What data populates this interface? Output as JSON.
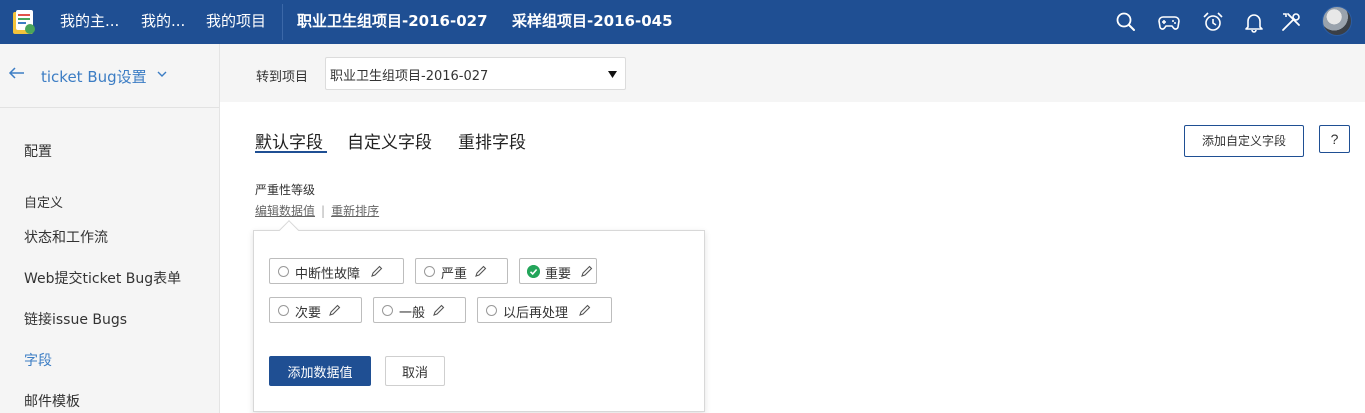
{
  "topbar": {
    "nav": [
      "我的主...",
      "我的...",
      "我的项目",
      "职业卫生组项目-2016-027",
      "采样组项目-2016-045"
    ],
    "icons": [
      "search-icon",
      "gamepad-icon",
      "alarm-clock-icon",
      "bell-icon",
      "tools-icon"
    ]
  },
  "sidebar": {
    "title": "ticket Bug设置",
    "items": [
      {
        "label": "配置"
      },
      {
        "label": "自定义"
      },
      {
        "label": "状态和工作流"
      },
      {
        "label": "Web提交ticket Bug表单"
      },
      {
        "label": "链接issue Bugs"
      },
      {
        "label": "字段"
      },
      {
        "label": "邮件模板"
      }
    ],
    "active_item": "字段"
  },
  "projectbar": {
    "label": "转到项目",
    "selected": "职业卫生组项目-2016-027"
  },
  "tabs": [
    "默认字段",
    "自定义字段",
    "重排字段"
  ],
  "active_tab": "默认字段",
  "actions": {
    "add_custom_field": "添加自定义字段",
    "help": "?"
  },
  "field": {
    "name": "严重性等级",
    "edit_values_link": "编辑数据值",
    "separator": "|",
    "reorder_link": "重新排序"
  },
  "values": [
    {
      "label": "中断性故障",
      "default": false
    },
    {
      "label": "严重",
      "default": false
    },
    {
      "label": "重要",
      "default": true
    },
    {
      "label": "次要",
      "default": false
    },
    {
      "label": "一般",
      "default": false
    },
    {
      "label": "以后再处理",
      "default": false
    }
  ],
  "popover": {
    "add_value_button": "添加数据值",
    "cancel_button": "取消"
  },
  "colors": {
    "topbar": "#1f4f93",
    "accent": "#3c7dc4",
    "default_check": "#23a55a"
  }
}
